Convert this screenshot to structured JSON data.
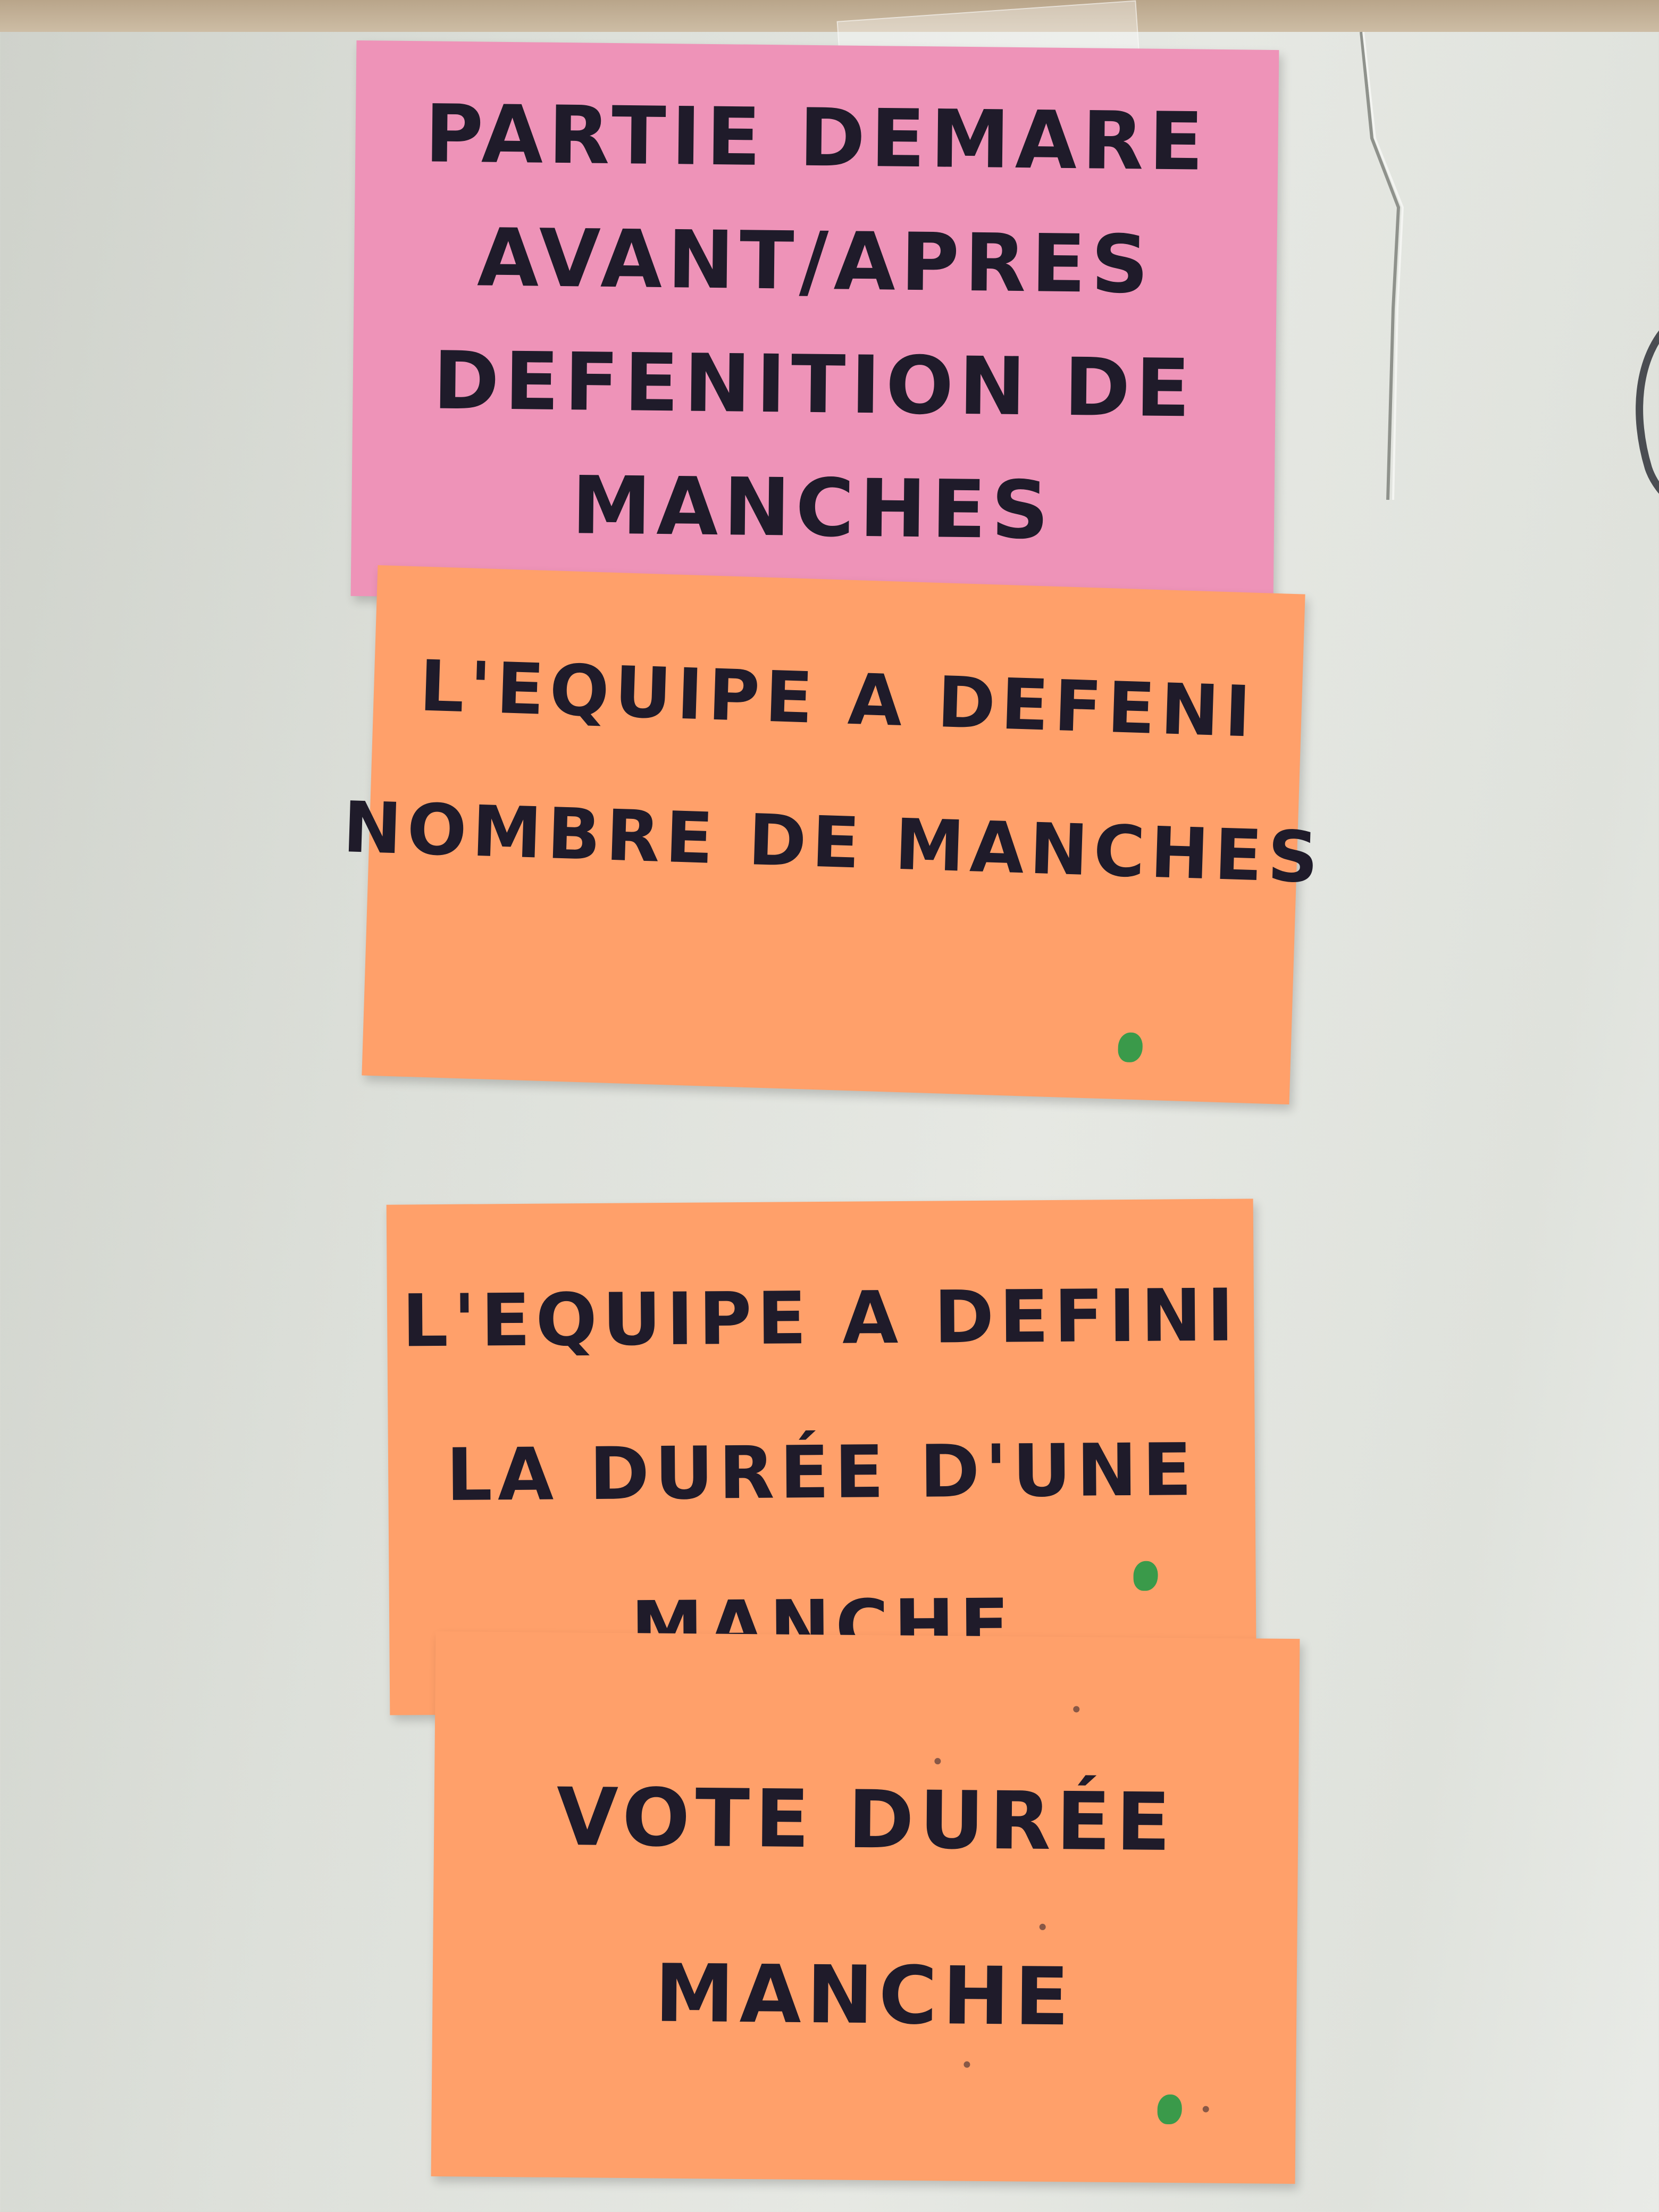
{
  "notes": [
    {
      "name": "pink-note-partie-demare",
      "color": "#ee93b8",
      "lines": [
        "PARTIE DEMARE",
        "AVANT/APRES",
        "DEFENITION DE",
        "MANCHES"
      ]
    },
    {
      "name": "orange-note-nombre-manches",
      "color": "#ffa06a",
      "dot_color": "#3a9a4a",
      "lines": [
        "L'EQUIPE A DEFENI",
        "NOMBRE DE MANCHES"
      ]
    },
    {
      "name": "orange-note-duree-manche",
      "color": "#ffa06a",
      "dot_color": "#3a9a4a",
      "lines": [
        "L'EQUIPE A DEFINI",
        "LA DURÉE D'UNE",
        "MANCHE"
      ]
    },
    {
      "name": "orange-note-vote-duree",
      "color": "#ffa06a",
      "dot_color": "#3a9a4a",
      "lines": [
        "VOTE DURÉE",
        "MANCHE"
      ]
    }
  ]
}
